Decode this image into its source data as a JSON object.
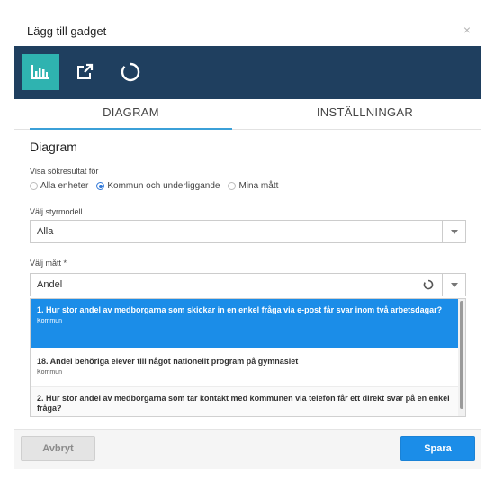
{
  "dialog": {
    "title": "Lägg till gadget",
    "close_symbol": "×"
  },
  "toolbar": {
    "tools": [
      {
        "icon": "bar-chart-icon",
        "active": true
      },
      {
        "icon": "external-link-icon",
        "active": false
      },
      {
        "icon": "circle-loader-icon",
        "active": false
      }
    ],
    "colors": {
      "background": "#1f3f5f",
      "active": "#2fb3b0"
    }
  },
  "tabs": [
    {
      "label": "DIAGRAM",
      "active": true
    },
    {
      "label": "INSTÄLLNINGAR",
      "active": false
    }
  ],
  "section": {
    "title": "Diagram"
  },
  "search_scope": {
    "label": "Visa sökresultat för",
    "options": [
      {
        "label": "Alla enheter",
        "selected": false
      },
      {
        "label": "Kommun och underliggande",
        "selected": true
      },
      {
        "label": "Mina mått",
        "selected": false
      }
    ]
  },
  "styrmodell": {
    "label": "Välj styrmodell",
    "value": "Alla"
  },
  "matt": {
    "label": "Välj mått *",
    "value": "Andel"
  },
  "results": [
    {
      "title": "1. Hur stor andel av medborgarna som skickar in en enkel fråga via e-post får svar inom två arbetsdagar?",
      "subtitle": "Kommun",
      "highlighted": true
    },
    {
      "title": "18. Andel behöriga elever till något nationellt program på gymnasiet",
      "subtitle": "Kommun",
      "highlighted": false
    },
    {
      "title": "2. Hur stor andel av medborgarna som tar kontakt med kommunen via telefon får ett direkt svar på en enkel fråga?",
      "subtitle": "",
      "highlighted": false
    }
  ],
  "footer": {
    "cancel_label": "Avbryt",
    "save_label": "Spara",
    "accent": "#1b8de8"
  }
}
